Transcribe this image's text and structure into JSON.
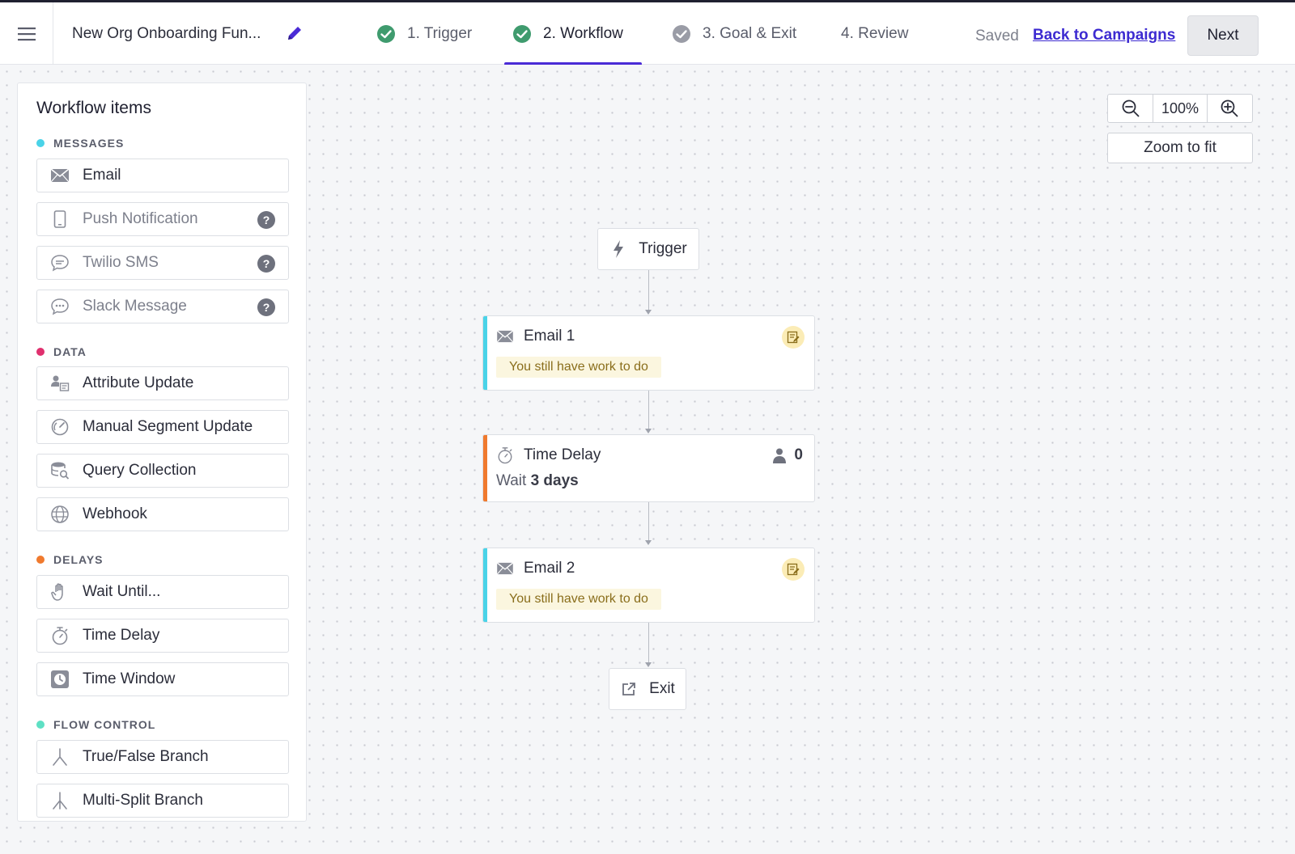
{
  "header": {
    "campaign_name": "New Org Onboarding Fun...",
    "steps": [
      {
        "label": "1. Trigger",
        "status": "complete"
      },
      {
        "label": "2. Workflow",
        "status": "complete-active"
      },
      {
        "label": "3. Goal & Exit",
        "status": "incomplete"
      },
      {
        "label": "4. Review",
        "status": "none"
      }
    ],
    "saved_label": "Saved",
    "back_label": "Back to Campaigns",
    "next_label": "Next"
  },
  "sidebar": {
    "title": "Workflow items",
    "sections": [
      {
        "name": "MESSAGES",
        "color": "#4ad3e8",
        "items": [
          {
            "label": "Email",
            "icon": "envelope-icon"
          },
          {
            "label": "Push Notification",
            "icon": "mobile-icon",
            "help": "?"
          },
          {
            "label": "Twilio SMS",
            "icon": "chat-bubble-icon",
            "help": "?"
          },
          {
            "label": "Slack Message",
            "icon": "chat-dots-icon",
            "help": "?"
          }
        ]
      },
      {
        "name": "DATA",
        "color": "#e0306e",
        "items": [
          {
            "label": "Attribute Update",
            "icon": "person-card-icon"
          },
          {
            "label": "Manual Segment Update",
            "icon": "segment-gauge-icon"
          },
          {
            "label": "Query Collection",
            "icon": "database-search-icon"
          },
          {
            "label": "Webhook",
            "icon": "globe-icon"
          }
        ]
      },
      {
        "name": "DELAYS",
        "color": "#f07a2e",
        "items": [
          {
            "label": "Wait Until...",
            "icon": "hand-icon"
          },
          {
            "label": "Time Delay",
            "icon": "stopwatch-icon"
          },
          {
            "label": "Time Window",
            "icon": "clock-square-icon"
          }
        ]
      },
      {
        "name": "FLOW CONTROL",
        "color": "#5ee0c4",
        "items": [
          {
            "label": "True/False Branch",
            "icon": "branch-two-icon"
          },
          {
            "label": "Multi-Split Branch",
            "icon": "branch-three-icon"
          }
        ]
      }
    ]
  },
  "zoom": {
    "level": "100%",
    "fit_label": "Zoom to fit"
  },
  "workflow": {
    "trigger_label": "Trigger",
    "nodes": [
      {
        "title": "Email 1",
        "warning": "You still have work to do",
        "accent": "#4ad3e8"
      },
      {
        "title": "Time Delay",
        "wait_prefix": "Wait",
        "wait_value": "3 days",
        "count": "0",
        "accent": "#f07a2e"
      },
      {
        "title": "Email 2",
        "warning": "You still have work to do",
        "accent": "#4ad3e8"
      }
    ],
    "exit_label": "Exit"
  }
}
